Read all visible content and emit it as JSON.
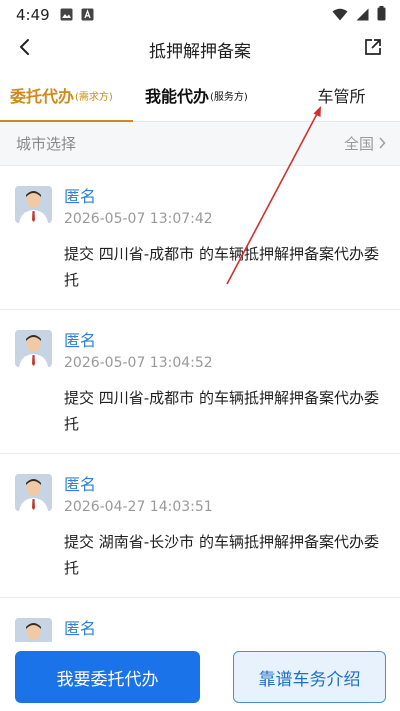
{
  "status_bar": {
    "time": "4:49"
  },
  "header": {
    "title": "抵押解押备案"
  },
  "tabs": [
    {
      "label": "委托代办",
      "sub": "(需求方)"
    },
    {
      "label": "我能代办",
      "sub": "(服务方)"
    },
    {
      "label": "车管所"
    }
  ],
  "city": {
    "label": "城市选择",
    "value": "全国"
  },
  "items": [
    {
      "name": "匿名",
      "time": "2026-05-07 13:07:42",
      "text": "提交 四川省-成都市 的车辆抵押解押备案代办委托"
    },
    {
      "name": "匿名",
      "time": "2026-05-07 13:04:52",
      "text": "提交 四川省-成都市 的车辆抵押解押备案代办委托"
    },
    {
      "name": "匿名",
      "time": "2026-04-27 14:03:51",
      "text": "提交 湖南省-长沙市 的车辆抵押解押备案代办委托"
    },
    {
      "name": "匿名",
      "time": "",
      "text": ""
    }
  ],
  "bottom": {
    "primary": "我要委托代办",
    "secondary": "靠谱车务介绍"
  },
  "colors": {
    "accent": "#d0891b",
    "link": "#2c82d8",
    "primary_button": "#1a73e8",
    "annotation": "#d32f2f"
  }
}
